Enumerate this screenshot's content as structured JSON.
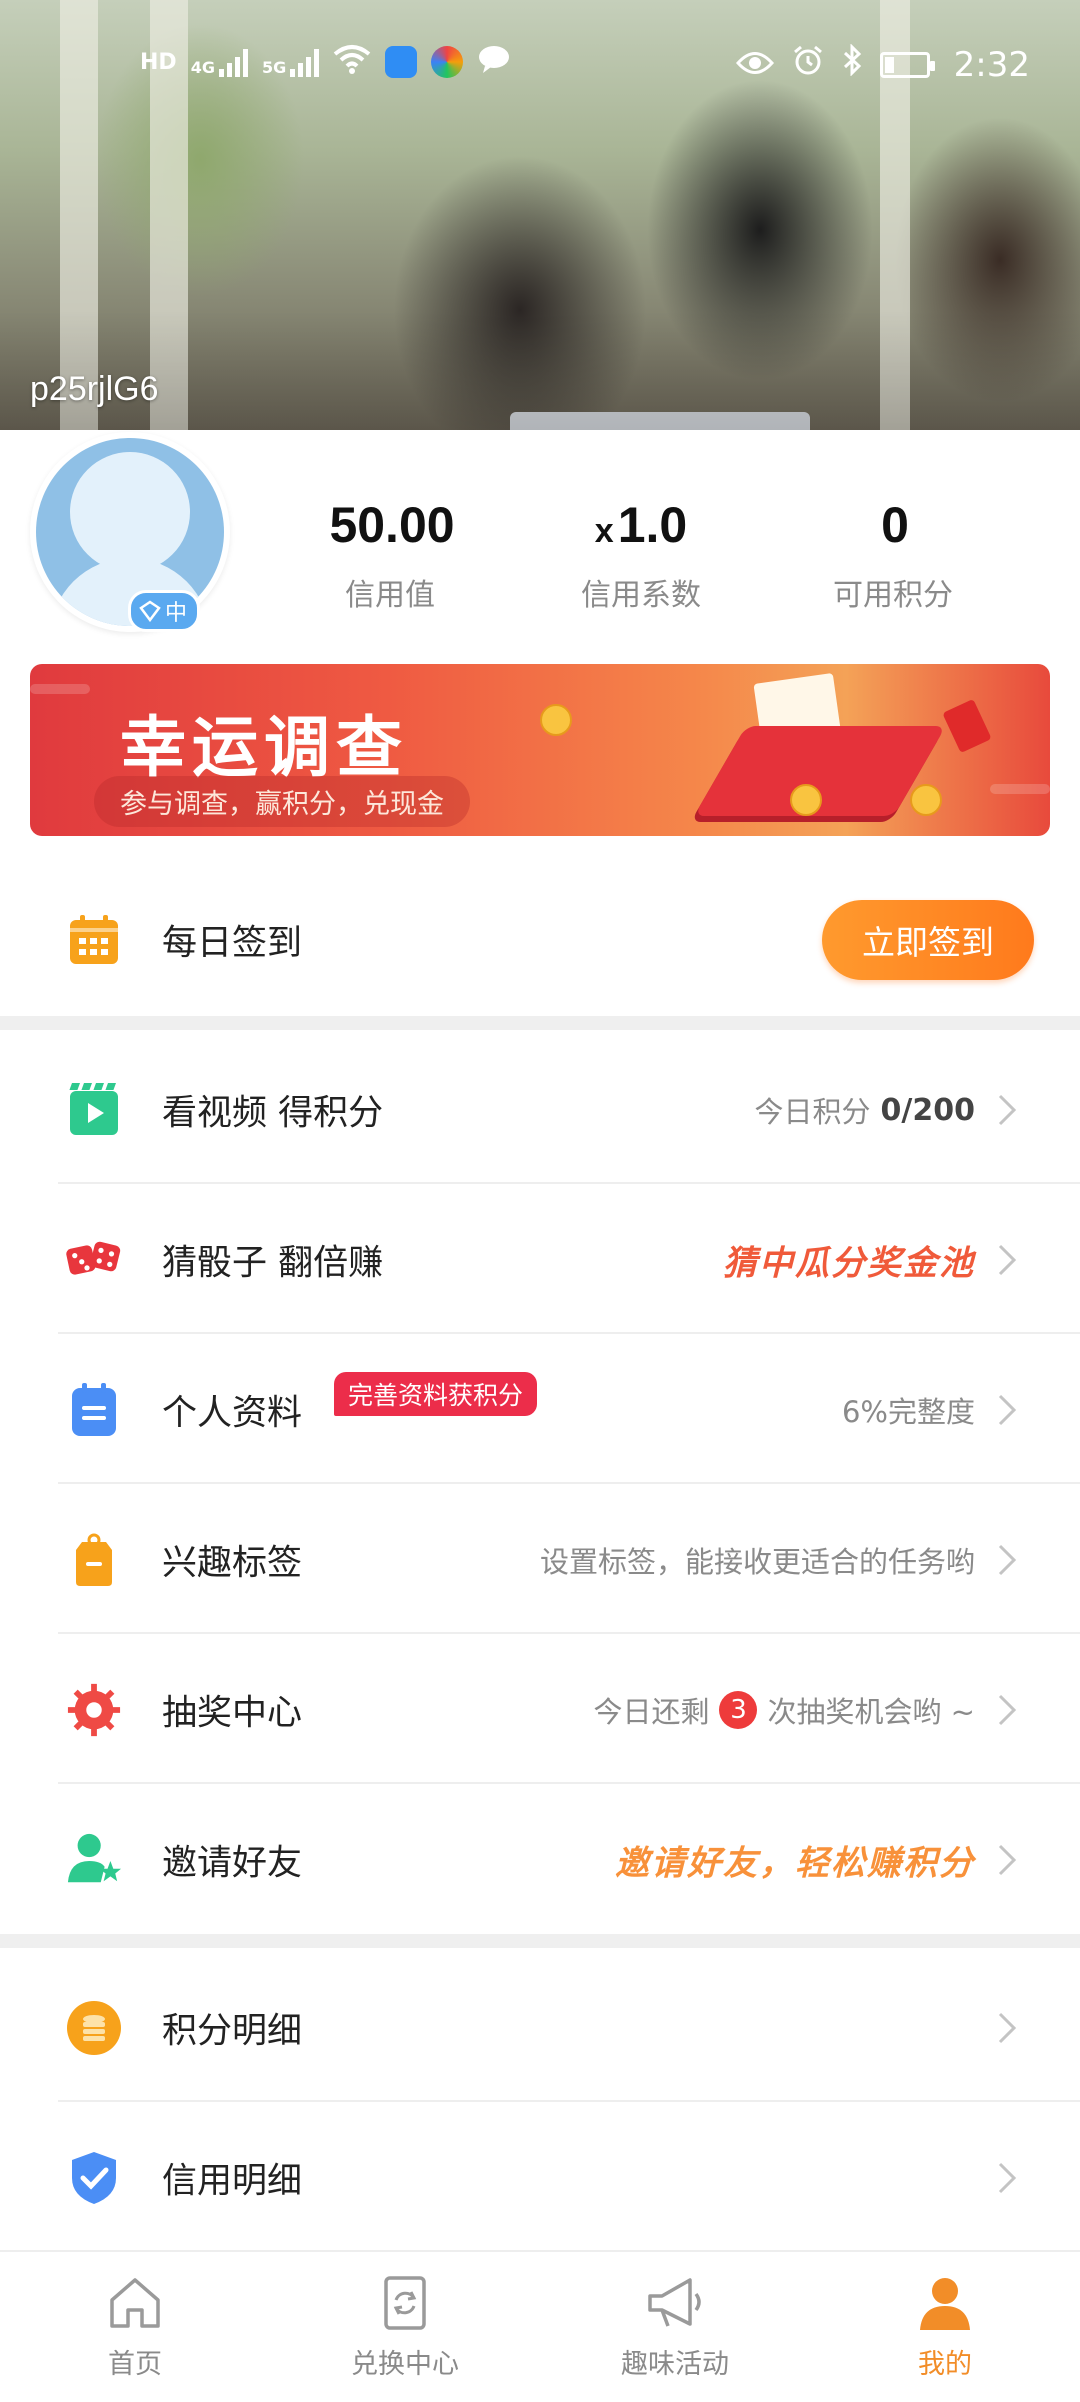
{
  "status_bar": {
    "time": "2:32",
    "network_labels": [
      "HD",
      "4G",
      "5G"
    ]
  },
  "profile": {
    "username": "p25rjlG6",
    "level_badge": "中",
    "stats": [
      {
        "value": "50.00",
        "prefix": "",
        "label": "信用值"
      },
      {
        "value": "1.0",
        "prefix": "x",
        "label": "信用系数"
      },
      {
        "value": "0",
        "prefix": "",
        "label": "可用积分"
      }
    ]
  },
  "banner": {
    "title": "幸运调查",
    "subtitle": "参与调查，赢积分，兑现金"
  },
  "checkin": {
    "label": "每日签到",
    "button": "立即签到"
  },
  "menu": {
    "video": {
      "label": "看视频 得积分",
      "right_prefix": "今日积分",
      "right_value": "0/200"
    },
    "dice": {
      "label": "猜骰子 翻倍赚",
      "right": "猜中瓜分奖金池"
    },
    "profile": {
      "label": "个人资料",
      "tag": "完善资料获积分",
      "right": "6%完整度"
    },
    "interests": {
      "label": "兴趣标签",
      "right": "设置标签，能接收更适合的任务哟"
    },
    "lottery": {
      "label": "抽奖中心",
      "right_prefix": "今日还剩",
      "count": "3",
      "right_suffix": "次抽奖机会哟 ~"
    },
    "invite": {
      "label": "邀请好友",
      "right": "邀请好友，轻松赚积分"
    },
    "points_detail": {
      "label": "积分明细"
    },
    "credit_detail": {
      "label": "信用明细"
    }
  },
  "bottom_nav": [
    {
      "label": "首页",
      "icon": "home-icon",
      "active": false
    },
    {
      "label": "兑换中心",
      "icon": "exchange-icon",
      "active": false
    },
    {
      "label": "趣味活动",
      "icon": "megaphone-icon",
      "active": false
    },
    {
      "label": "我的",
      "icon": "user-icon",
      "active": true
    }
  ],
  "colors": {
    "accent": "#f28d28",
    "button": "#ff8a24",
    "badge_red": "#ec2d4a",
    "muted": "#8a8a8a"
  }
}
